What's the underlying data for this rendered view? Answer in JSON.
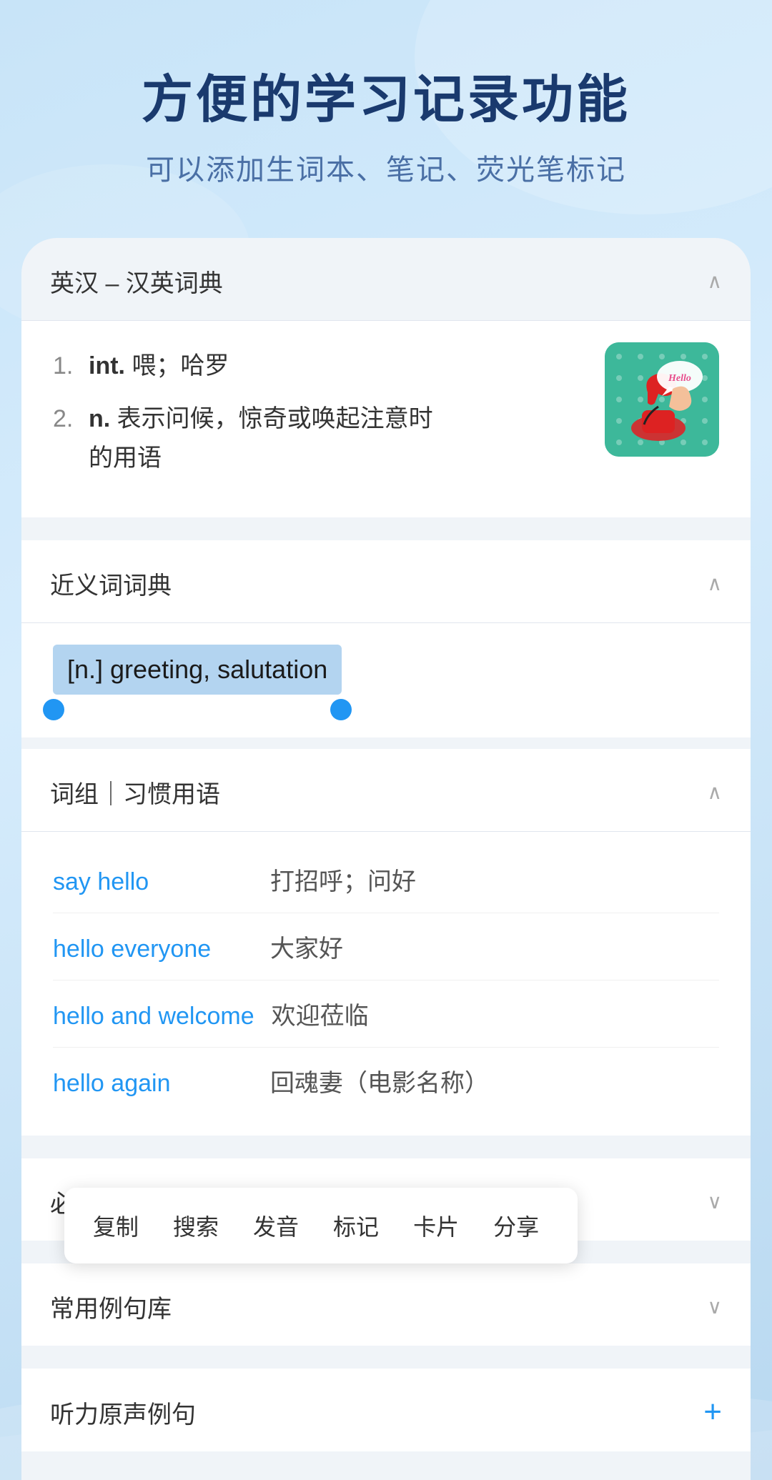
{
  "header": {
    "title": "方便的学习记录功能",
    "subtitle": "可以添加生词本、笔记、荧光笔标记"
  },
  "dictionary_section": {
    "title": "英汉 – 汉英词典",
    "chevron": "∧",
    "definitions": [
      {
        "num": "1.",
        "type": "int.",
        "text": "喂；哈罗"
      },
      {
        "num": "2.",
        "type": "n.",
        "text": "表示问候，惊奇或唤起注意时的用语"
      }
    ]
  },
  "synonym_section": {
    "title": "近义词词典",
    "chevron": "∧",
    "highlighted_text": "[n.] greeting, salutation"
  },
  "context_menu": {
    "items": [
      "复制",
      "搜索",
      "发音",
      "标记",
      "卡片",
      "分享"
    ]
  },
  "phrases_section": {
    "title": "词组｜习惯用语",
    "chevron": "∧",
    "phrases": [
      {
        "en": "say hello",
        "zh": "打招呼；问好"
      },
      {
        "en": "hello everyone",
        "zh": "大家好"
      },
      {
        "en": "hello and welcome",
        "zh": "欢迎莅临"
      },
      {
        "en": "hello again",
        "zh": "回魂妻（电影名称）"
      }
    ]
  },
  "biyingSection": {
    "title": "必应在线词典",
    "chevron": "∨"
  },
  "changyongSection": {
    "title": "常用例句库",
    "chevron": "∨"
  },
  "tingli_section": {
    "title": "听力原声例句",
    "plus": "+"
  },
  "icons": {
    "chevron_up": "∧",
    "chevron_down": "∨",
    "plus": "+"
  },
  "hello_image": {
    "label": "Hello telephone illustration"
  }
}
